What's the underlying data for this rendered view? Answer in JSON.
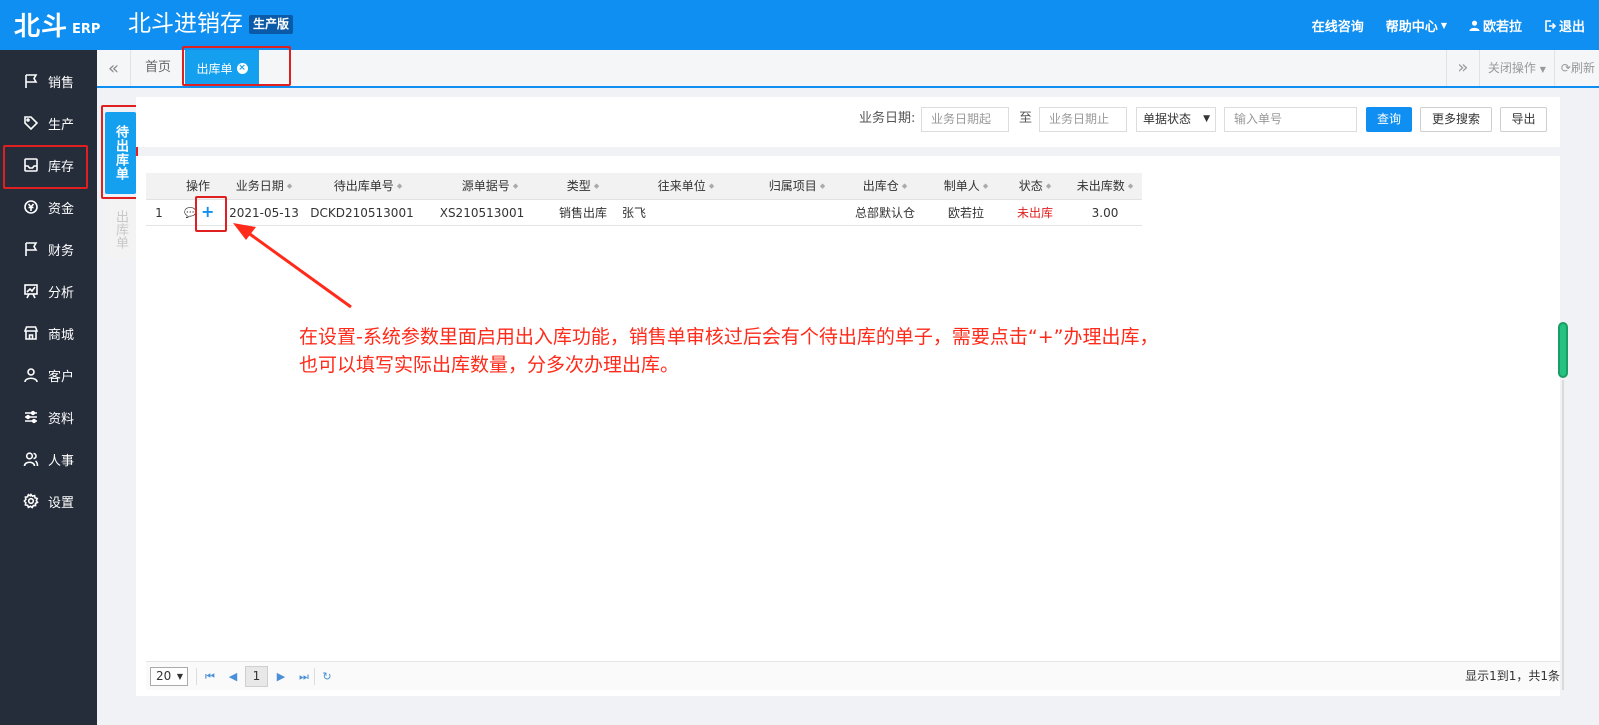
{
  "header": {
    "logo_cn": "北斗",
    "logo_en": "ERP",
    "app_title": "北斗进销存",
    "edition": "生产版",
    "links": {
      "consult": "在线咨询",
      "help": "帮助中心",
      "user": "欧若拉",
      "logout": "退出"
    }
  },
  "sidebar": {
    "items": [
      {
        "label": "销售",
        "icon": "flag-icon"
      },
      {
        "label": "生产",
        "icon": "tag-icon"
      },
      {
        "label": "库存",
        "icon": "inbox-icon"
      },
      {
        "label": "资金",
        "icon": "coin-icon"
      },
      {
        "label": "财务",
        "icon": "flag-icon"
      },
      {
        "label": "分析",
        "icon": "chart-icon"
      },
      {
        "label": "商城",
        "icon": "store-icon"
      },
      {
        "label": "客户",
        "icon": "user-icon"
      },
      {
        "label": "资料",
        "icon": "sliders-icon"
      },
      {
        "label": "人事",
        "icon": "users-icon"
      },
      {
        "label": "设置",
        "icon": "gear-icon"
      }
    ]
  },
  "tabs": {
    "home": "首页",
    "active": "出库单",
    "close_ops": "关闭操作",
    "refresh": "刷新"
  },
  "vtabs": {
    "active": "待出库单",
    "other": "出库单"
  },
  "filter": {
    "date_label": "业务日期:",
    "date_start_placeholder": "业务日期起",
    "to_label": "至",
    "date_end_placeholder": "业务日期止",
    "status_select": "单据状态",
    "order_placeholder": "输入单号",
    "query": "查询",
    "more_search": "更多搜索",
    "export": "导出"
  },
  "table": {
    "columns": [
      "操作",
      "业务日期",
      "待出库单号",
      "源单据号",
      "类型",
      "往来单位",
      "归属项目",
      "出库仓",
      "制单人",
      "状态",
      "未出库数"
    ],
    "rows": [
      {
        "no": "1",
        "date": "2021-05-13",
        "pending_no": "DCKD210513001",
        "source_no": "XS210513001",
        "type": "销售出库",
        "partner": "张飞",
        "project": "",
        "warehouse": "总部默认仓",
        "creator": "欧若拉",
        "status": "未出库",
        "qty": "3.00"
      }
    ]
  },
  "pager": {
    "page_size": "20",
    "current_page": "1",
    "info": "显示1到1，共1条"
  },
  "annotation": {
    "line1": "在设置-系统参数里面启用出入库功能，销售单审核过后会有个待出库的单子，需要点击“+”办理出库，",
    "line2": "也可以填写实际出库数量，分多次办理出库。"
  },
  "colors": {
    "primary": "#0f8ff1",
    "sidebar_bg": "#252d3a",
    "highlight_red": "#e02020",
    "annotation_red": "#ff2a1a"
  }
}
